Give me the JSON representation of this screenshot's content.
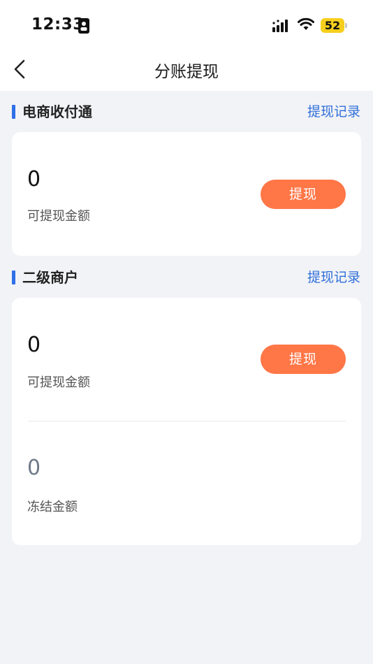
{
  "status_bar": {
    "time": "12:33",
    "battery": "52"
  },
  "nav": {
    "title": "分账提现"
  },
  "sections": [
    {
      "title": "电商收付通",
      "link": "提现记录",
      "available_amount": "0",
      "available_label": "可提现金额",
      "button_label": "提现"
    },
    {
      "title": "二级商户",
      "link": "提现记录",
      "available_amount": "0",
      "available_label": "可提现金额",
      "button_label": "提现",
      "frozen_amount": "0",
      "frozen_label": "冻结金额"
    }
  ],
  "colors": {
    "accent": "#2f6fe8",
    "button": "#ff7647",
    "battery": "#f6cf1e"
  }
}
